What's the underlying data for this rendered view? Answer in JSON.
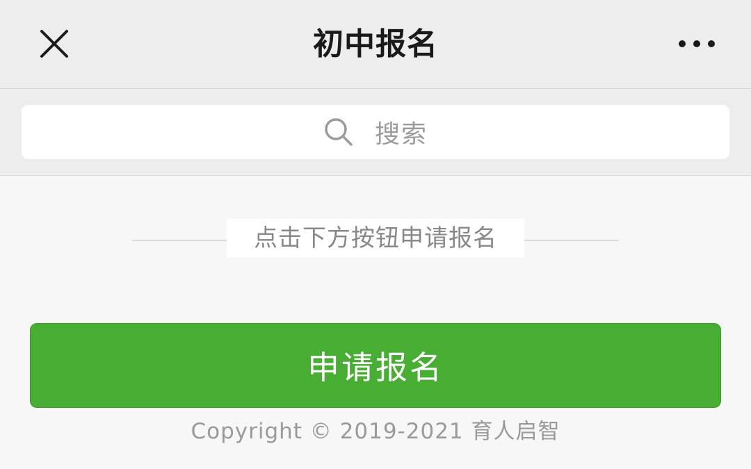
{
  "nav": {
    "title": "初中报名",
    "close_icon": "close-icon",
    "more_icon": "more-horizontal-icon"
  },
  "search": {
    "placeholder": "搜索",
    "icon": "search-icon"
  },
  "hint": {
    "text": "点击下方按钮申请报名"
  },
  "apply_button": {
    "label": "申请报名"
  },
  "footer": {
    "copyright": "Copyright © 2019-2021 育人启智"
  },
  "colors": {
    "nav_bg": "#ededed",
    "page_bg": "#f7f7f7",
    "button_green": "#47ad33",
    "title_text": "#1a1a1a",
    "muted_text": "#9b9b9b"
  }
}
